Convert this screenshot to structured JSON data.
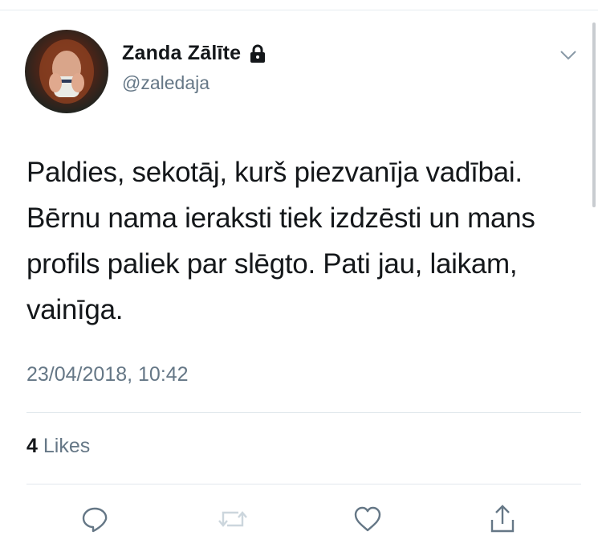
{
  "tweet": {
    "author": {
      "display_name": "Zanda Zālīte",
      "handle": "@zaledaja",
      "avatar_icon": "profile-photo",
      "protected_icon": "lock-icon"
    },
    "text": "Paldies, sekotāj, kurš piezvanīja vadībai. Bērnu nama ieraksti tiek izdzēsti un mans profils paliek par slēgto. Pati jau, laikam, vainīga.",
    "timestamp": "23/04/2018, 10:42",
    "likes": {
      "count": "4",
      "label": "Likes"
    }
  },
  "actions": [
    {
      "name": "reply",
      "icon": "speech-bubble-icon"
    },
    {
      "name": "retweet",
      "icon": "retweet-icon"
    },
    {
      "name": "like",
      "icon": "heart-icon"
    },
    {
      "name": "share",
      "icon": "share-icon"
    }
  ],
  "colors": {
    "text_primary": "#14171a",
    "text_secondary": "#657786",
    "icon": "#657786",
    "icon_disabled": "#ccd6dd",
    "divider": "#e1e8ed"
  }
}
